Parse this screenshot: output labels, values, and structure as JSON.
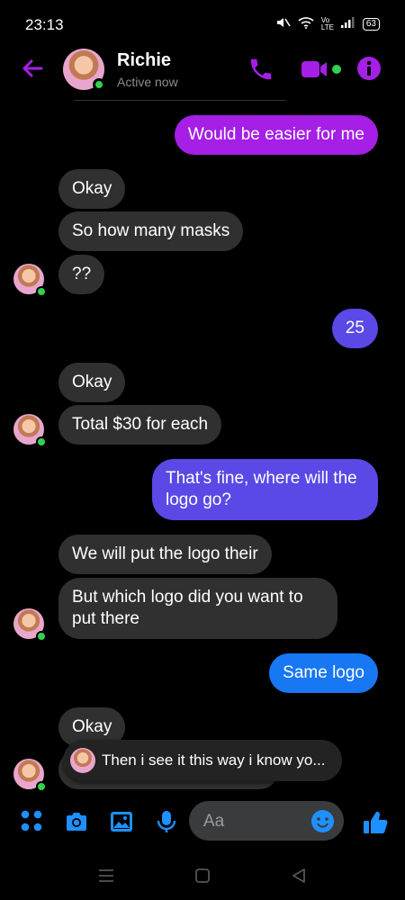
{
  "status_bar": {
    "time": "23:13",
    "signal_label": "Vo LTE",
    "battery": "63"
  },
  "header": {
    "contact_name": "Richie",
    "presence": "Active now"
  },
  "messages": [
    {
      "side": "out",
      "text": "Would be easier for me"
    },
    {
      "side": "in",
      "text": "Okay"
    },
    {
      "side": "in",
      "text": "So how many masks"
    },
    {
      "side": "in",
      "text": "??"
    },
    {
      "side": "out",
      "text": "25"
    },
    {
      "side": "in",
      "text": "Okay"
    },
    {
      "side": "in",
      "text": "Total $30 for each"
    },
    {
      "side": "out",
      "text": "That's fine, where will the",
      "text2": "logo go?"
    },
    {
      "side": "in",
      "text": "We will put the logo their"
    },
    {
      "side": "in",
      "text": "But which logo did you want to",
      "text2": "put there"
    },
    {
      "side": "out",
      "text": "Same logo"
    },
    {
      "side": "in",
      "text": "Okay"
    }
  ],
  "reply_preview": {
    "text": "Then i see it this way i know yo..."
  },
  "composer": {
    "placeholder": "Aa"
  },
  "colors": {
    "accent": "#a51fe6",
    "outgoing_mid": "#5a49e6",
    "outgoing_blue": "#1877f2",
    "incoming": "#303030",
    "online": "#31d152"
  }
}
